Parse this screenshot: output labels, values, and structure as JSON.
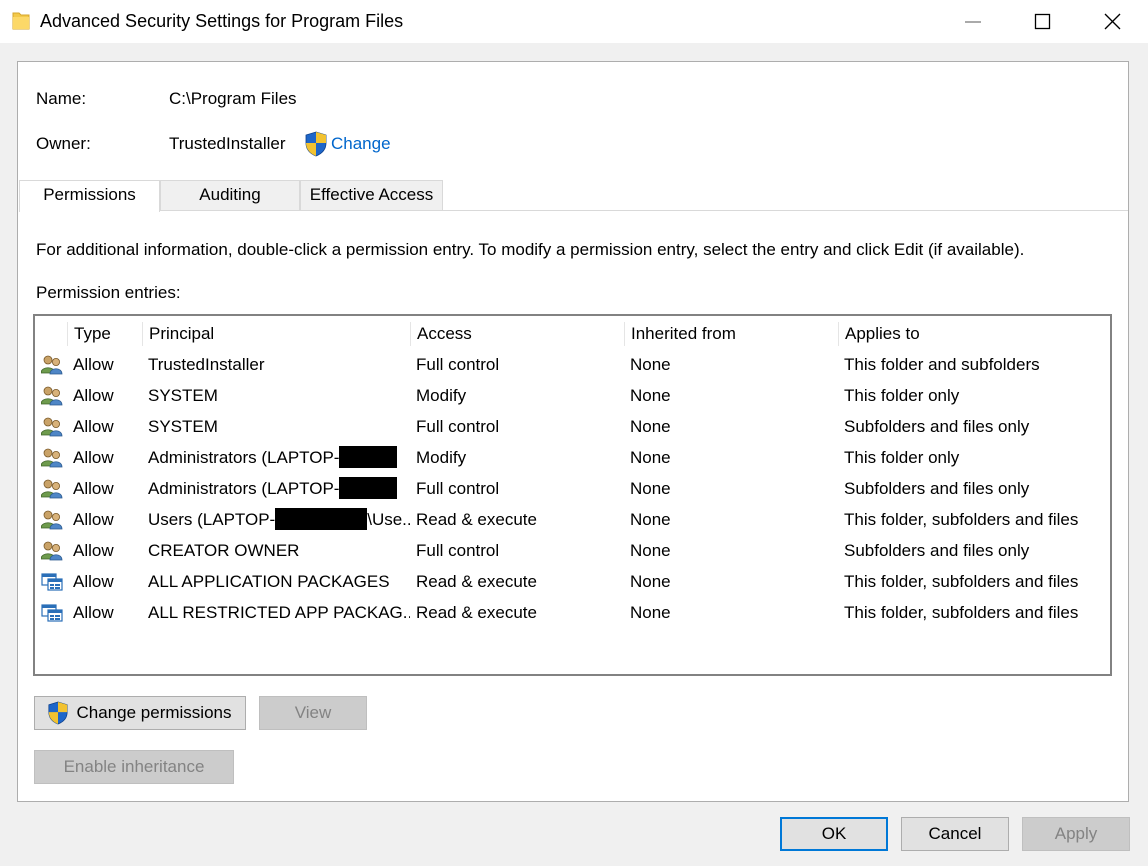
{
  "window": {
    "title": "Advanced Security Settings for Program Files"
  },
  "object": {
    "name_label": "Name:",
    "name_value": "C:\\Program Files",
    "owner_label": "Owner:",
    "owner_value": "TrustedInstaller",
    "change_link": "Change"
  },
  "tabs": [
    {
      "label": "Permissions",
      "active": true
    },
    {
      "label": "Auditing",
      "active": false
    },
    {
      "label": "Effective Access",
      "active": false
    }
  ],
  "info_text": "For additional information, double-click a permission entry. To modify a permission entry, select the entry and click Edit (if available).",
  "entries_label": "Permission entries:",
  "columns": {
    "type": "Type",
    "principal": "Principal",
    "access": "Access",
    "inherited": "Inherited from",
    "applies": "Applies to"
  },
  "entries": [
    {
      "icon": "users-icon",
      "type": "Allow",
      "principal_a": "TrustedInstaller",
      "principal_b": "",
      "access": "Full control",
      "inherited": "None",
      "applies": "This folder and subfolders"
    },
    {
      "icon": "users-icon",
      "type": "Allow",
      "principal_a": "SYSTEM",
      "principal_b": "",
      "access": "Modify",
      "inherited": "None",
      "applies": "This folder only"
    },
    {
      "icon": "users-icon",
      "type": "Allow",
      "principal_a": "SYSTEM",
      "principal_b": "",
      "access": "Full control",
      "inherited": "None",
      "applies": "Subfolders and files only"
    },
    {
      "icon": "users-icon",
      "type": "Allow",
      "principal_a": "Administrators (LAPTOP-",
      "principal_b": "",
      "access": "Modify",
      "inherited": "None",
      "applies": "This folder only"
    },
    {
      "icon": "users-icon",
      "type": "Allow",
      "principal_a": "Administrators (LAPTOP-",
      "principal_b": "",
      "access": "Full control",
      "inherited": "None",
      "applies": "Subfolders and files only"
    },
    {
      "icon": "users-icon",
      "type": "Allow",
      "principal_a": "Users (LAPTOP-",
      "principal_b": "\\Use...",
      "access": "Read & execute",
      "inherited": "None",
      "applies": "This folder, subfolders and files"
    },
    {
      "icon": "users-icon",
      "type": "Allow",
      "principal_a": "CREATOR OWNER",
      "principal_b": "",
      "access": "Full control",
      "inherited": "None",
      "applies": "Subfolders and files only"
    },
    {
      "icon": "app-packages-icon",
      "type": "Allow",
      "principal_a": "ALL APPLICATION PACKAGES",
      "principal_b": "",
      "access": "Read & execute",
      "inherited": "None",
      "applies": "This folder, subfolders and files"
    },
    {
      "icon": "app-packages-icon",
      "type": "Allow",
      "principal_a": "ALL RESTRICTED APP PACKAG...",
      "principal_b": "",
      "access": "Read & execute",
      "inherited": "None",
      "applies": "This folder, subfolders and files"
    }
  ],
  "buttons": {
    "change_permissions": "Change permissions",
    "view": "View",
    "enable_inheritance": "Enable inheritance",
    "ok": "OK",
    "cancel": "Cancel",
    "apply": "Apply"
  }
}
